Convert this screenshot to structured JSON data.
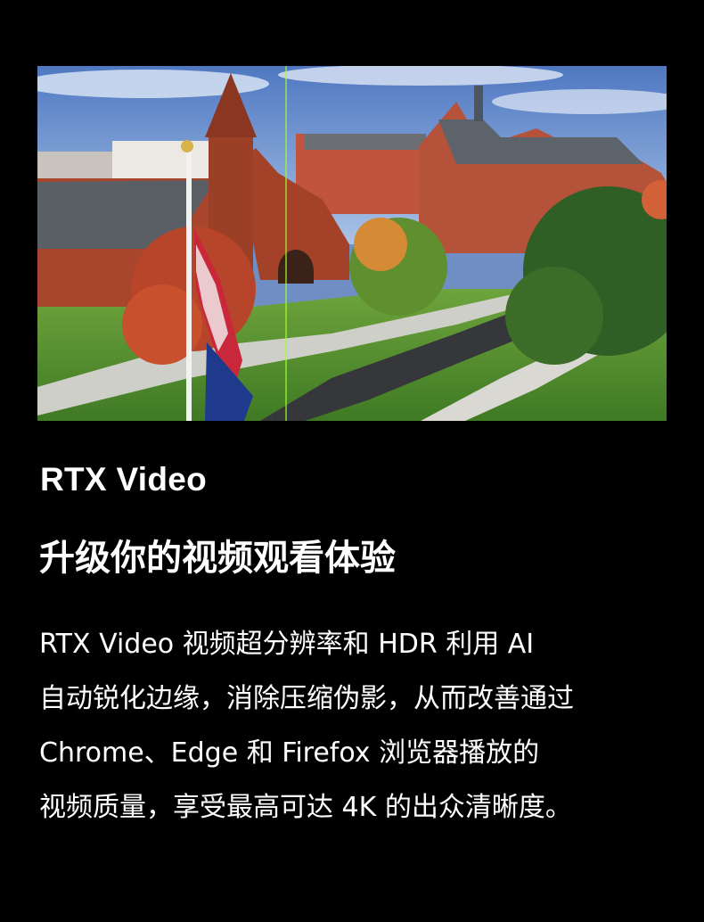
{
  "colors": {
    "background": "#000000",
    "text": "#ffffff"
  },
  "hero": {
    "subject": "aerial view of campus with red brick buildings and flag",
    "icon": "photo-icon"
  },
  "eyebrow": "RTX Video",
  "headline": "升级你的视频观看体验",
  "description": {
    "lines": [
      "RTX Video 视频超分辨率和 HDR 利用 AI",
      "自动锐化边缘，消除压缩伪影，从而改善通过",
      "Chrome、Edge 和 Firefox 浏览器播放的",
      "视频质量，享受最高可达 4K 的出众清晰度。"
    ]
  }
}
